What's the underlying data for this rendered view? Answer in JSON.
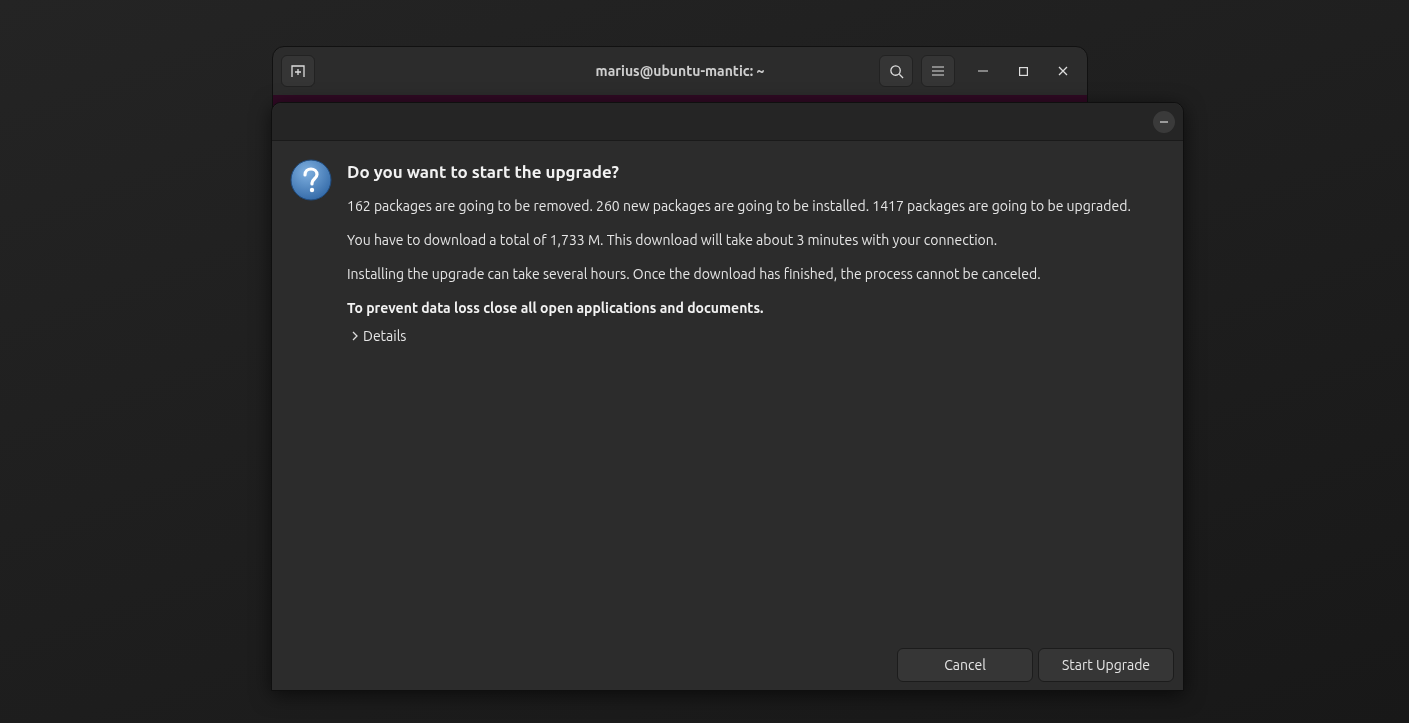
{
  "terminal": {
    "title": "marius@ubuntu-mantic: ~"
  },
  "dialog": {
    "title": "Do you want to start the upgrade?",
    "paragraphs": [
      "162 packages are going to be removed. 260 new packages are going to be installed. 1417 packages are going to be upgraded.",
      "You have to download a total of 1,733 M. This download will take about 3 minutes with your connection.",
      "Installing the upgrade can take several hours. Once the download has finished, the process cannot be canceled."
    ],
    "warning": "To prevent data loss close all open applications and documents.",
    "details": {
      "label": "Details",
      "expanded": false
    },
    "buttons": [
      "Cancel",
      "Start Upgrade"
    ]
  }
}
